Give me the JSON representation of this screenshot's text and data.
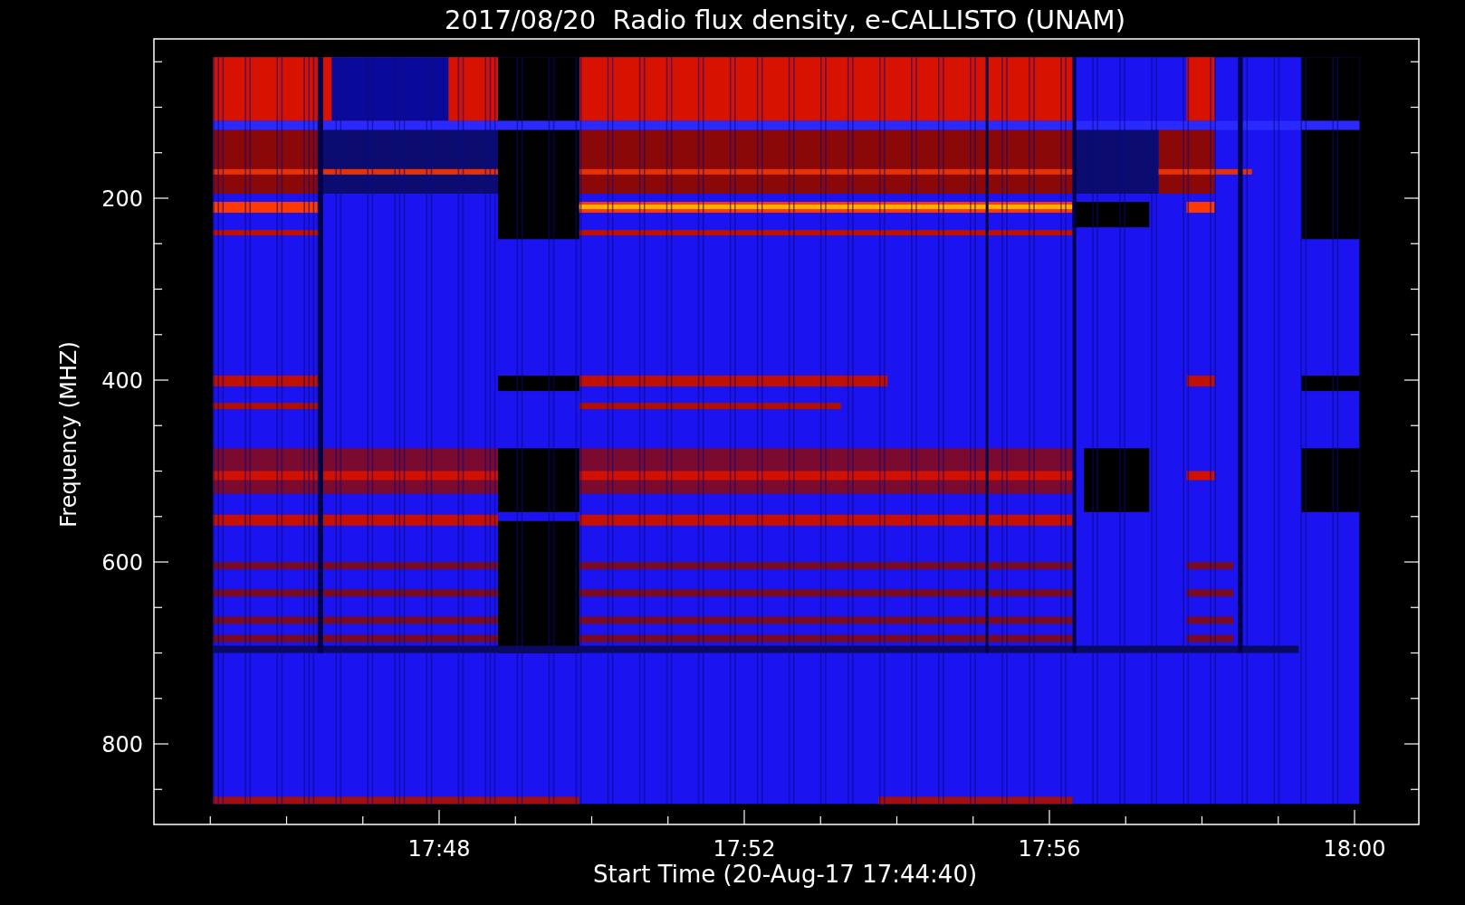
{
  "title": "2017/08/20  Radio flux density, e-CALLISTO (UNAM)",
  "y_axis": {
    "label": "Frequency (MHZ)",
    "ticks": [
      "200",
      "400",
      "600",
      "800"
    ]
  },
  "x_axis": {
    "label": "Start Time (20-Aug-17 17:44:40)",
    "ticks": [
      "17:48",
      "17:52",
      "17:56",
      "18:00"
    ]
  }
}
